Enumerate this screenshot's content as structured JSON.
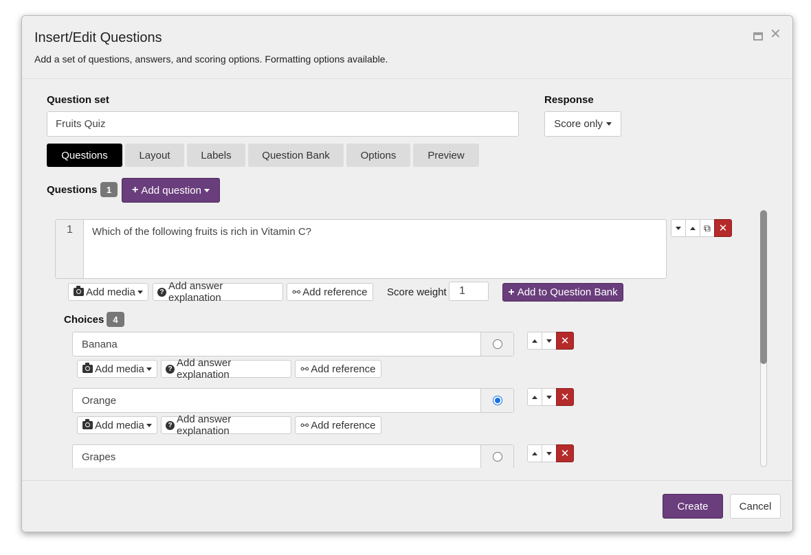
{
  "dialog": {
    "title": "Insert/Edit Questions",
    "description": "Add a set of questions, answers, and scoring options. Formatting options available."
  },
  "question_set": {
    "label": "Question set",
    "value": "Fruits Quiz"
  },
  "response": {
    "label": "Response",
    "selected": "Score only"
  },
  "tabs": [
    {
      "label": "Questions",
      "active": true
    },
    {
      "label": "Layout",
      "active": false
    },
    {
      "label": "Labels",
      "active": false
    },
    {
      "label": "Question Bank",
      "active": false
    },
    {
      "label": "Options",
      "active": false
    },
    {
      "label": "Preview",
      "active": false
    }
  ],
  "questions_section": {
    "label": "Questions",
    "count": "1",
    "add_question_label": "Add question"
  },
  "question": {
    "number": "1",
    "text": "Which of the following fruits is rich in Vitamin C?",
    "add_media_label": "Add media",
    "add_explanation_label": "Add answer explanation",
    "add_reference_label": "Add reference",
    "score_weight_label": "Score weight",
    "score_weight_value": "1",
    "add_to_bank_label": "Add to Question Bank"
  },
  "choices_section": {
    "label": "Choices",
    "count": "4"
  },
  "choices": [
    {
      "text": "Banana",
      "correct": false,
      "add_media_label": "Add media",
      "add_explanation_label": "Add answer explanation",
      "add_reference_label": "Add reference"
    },
    {
      "text": "Orange",
      "correct": true,
      "add_media_label": "Add media",
      "add_explanation_label": "Add answer explanation",
      "add_reference_label": "Add reference"
    },
    {
      "text": "Grapes",
      "correct": false
    }
  ],
  "footer": {
    "create_label": "Create",
    "cancel_label": "Cancel"
  },
  "colors": {
    "accent_purple": "#6a3d7c",
    "delete_red": "#b52a2a",
    "radio_blue": "#1a73e8"
  },
  "icons": {
    "plus": "+",
    "close": "✕",
    "copy": "⧉",
    "link": "🔗"
  }
}
